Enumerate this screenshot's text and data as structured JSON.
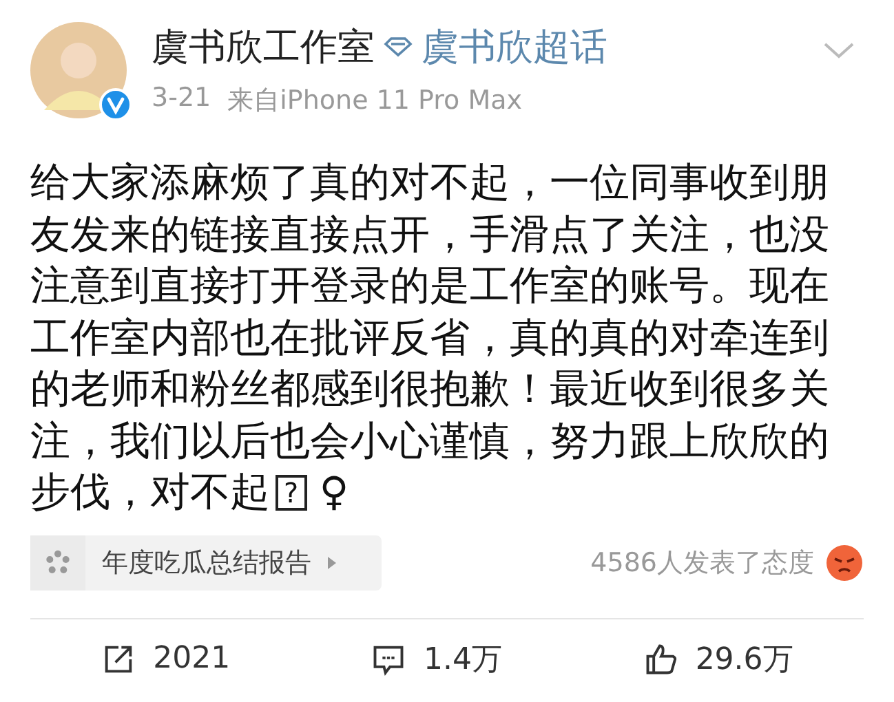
{
  "post": {
    "author": "虞书欣工作室",
    "verified": true,
    "topic": "虞书欣超话",
    "date": "3-21",
    "source": "来自iPhone 11 Pro Max"
  },
  "body": {
    "text": "给大家添麻烦了真的对不起，一位同事收到朋友发来的链接直接点开，手滑点了关注，也没注意到直接打开登录的是工作室的账号。现在工作室内部也在批评反省，真的真的对牵连到的老师和粉丝都感到很抱歉！最近收到很多关注，我们以后也会小心谨慎，努力跟上欣欣的步伐，对不起",
    "unknown_glyph": "?",
    "symbol": "♀"
  },
  "card": {
    "label": "年度吃瓜总结报告"
  },
  "reactions": {
    "text": "4586人发表了态度"
  },
  "actions": [
    {
      "kind": "share",
      "count": "2021"
    },
    {
      "kind": "comment",
      "count": "1.4万"
    },
    {
      "kind": "like",
      "count": "29.6万"
    }
  ]
}
